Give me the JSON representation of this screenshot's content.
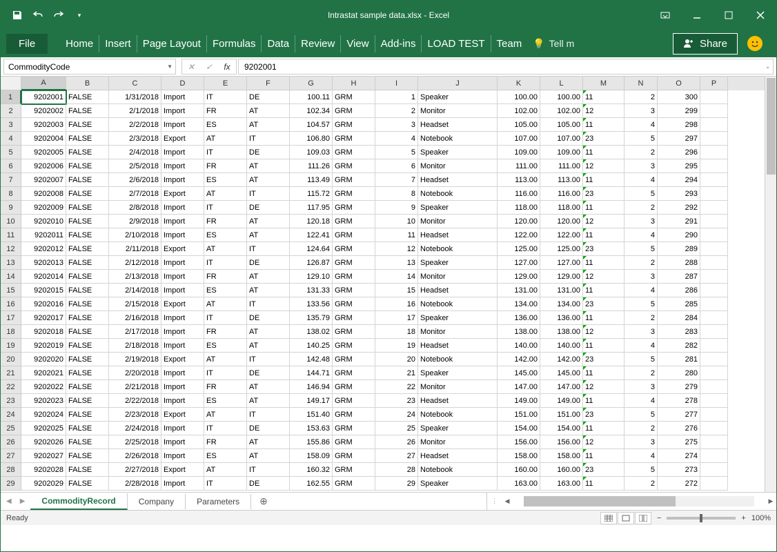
{
  "title": "Intrastat sample data.xlsx - Excel",
  "ribbon": {
    "file": "File",
    "tabs": [
      "Home",
      "Insert",
      "Page Layout",
      "Formulas",
      "Data",
      "Review",
      "View",
      "Add-ins",
      "LOAD TEST",
      "Team"
    ],
    "tell_me": "Tell m",
    "share": "Share"
  },
  "namebox": "CommodityCode",
  "formula": "9202001",
  "columns": [
    "A",
    "B",
    "C",
    "D",
    "E",
    "F",
    "G",
    "H",
    "I",
    "J",
    "K",
    "L",
    "M",
    "N",
    "O",
    "P"
  ],
  "rows": [
    {
      "n": 1,
      "A": "9202001",
      "B": "FALSE",
      "C": "1/31/2018",
      "D": "Import",
      "E": "IT",
      "F": "DE",
      "G": "100.11",
      "H": "GRM",
      "I": "1",
      "J": "Speaker",
      "K": "100.00",
      "L": "100.00",
      "M": "11",
      "N": "2",
      "O": "300"
    },
    {
      "n": 2,
      "A": "9202002",
      "B": "FALSE",
      "C": "2/1/2018",
      "D": "Import",
      "E": "FR",
      "F": "AT",
      "G": "102.34",
      "H": "GRM",
      "I": "2",
      "J": "Monitor",
      "K": "102.00",
      "L": "102.00",
      "M": "12",
      "N": "3",
      "O": "299"
    },
    {
      "n": 3,
      "A": "9202003",
      "B": "FALSE",
      "C": "2/2/2018",
      "D": "Import",
      "E": "ES",
      "F": "AT",
      "G": "104.57",
      "H": "GRM",
      "I": "3",
      "J": "Headset",
      "K": "105.00",
      "L": "105.00",
      "M": "11",
      "N": "4",
      "O": "298"
    },
    {
      "n": 4,
      "A": "9202004",
      "B": "FALSE",
      "C": "2/3/2018",
      "D": "Export",
      "E": "AT",
      "F": "IT",
      "G": "106.80",
      "H": "GRM",
      "I": "4",
      "J": "Notebook",
      "K": "107.00",
      "L": "107.00",
      "M": "23",
      "N": "5",
      "O": "297"
    },
    {
      "n": 5,
      "A": "9202005",
      "B": "FALSE",
      "C": "2/4/2018",
      "D": "Import",
      "E": "IT",
      "F": "DE",
      "G": "109.03",
      "H": "GRM",
      "I": "5",
      "J": "Speaker",
      "K": "109.00",
      "L": "109.00",
      "M": "11",
      "N": "2",
      "O": "296"
    },
    {
      "n": 6,
      "A": "9202006",
      "B": "FALSE",
      "C": "2/5/2018",
      "D": "Import",
      "E": "FR",
      "F": "AT",
      "G": "111.26",
      "H": "GRM",
      "I": "6",
      "J": "Monitor",
      "K": "111.00",
      "L": "111.00",
      "M": "12",
      "N": "3",
      "O": "295"
    },
    {
      "n": 7,
      "A": "9202007",
      "B": "FALSE",
      "C": "2/6/2018",
      "D": "Import",
      "E": "ES",
      "F": "AT",
      "G": "113.49",
      "H": "GRM",
      "I": "7",
      "J": "Headset",
      "K": "113.00",
      "L": "113.00",
      "M": "11",
      "N": "4",
      "O": "294"
    },
    {
      "n": 8,
      "A": "9202008",
      "B": "FALSE",
      "C": "2/7/2018",
      "D": "Export",
      "E": "AT",
      "F": "IT",
      "G": "115.72",
      "H": "GRM",
      "I": "8",
      "J": "Notebook",
      "K": "116.00",
      "L": "116.00",
      "M": "23",
      "N": "5",
      "O": "293"
    },
    {
      "n": 9,
      "A": "9202009",
      "B": "FALSE",
      "C": "2/8/2018",
      "D": "Import",
      "E": "IT",
      "F": "DE",
      "G": "117.95",
      "H": "GRM",
      "I": "9",
      "J": "Speaker",
      "K": "118.00",
      "L": "118.00",
      "M": "11",
      "N": "2",
      "O": "292"
    },
    {
      "n": 10,
      "A": "9202010",
      "B": "FALSE",
      "C": "2/9/2018",
      "D": "Import",
      "E": "FR",
      "F": "AT",
      "G": "120.18",
      "H": "GRM",
      "I": "10",
      "J": "Monitor",
      "K": "120.00",
      "L": "120.00",
      "M": "12",
      "N": "3",
      "O": "291"
    },
    {
      "n": 11,
      "A": "9202011",
      "B": "FALSE",
      "C": "2/10/2018",
      "D": "Import",
      "E": "ES",
      "F": "AT",
      "G": "122.41",
      "H": "GRM",
      "I": "11",
      "J": "Headset",
      "K": "122.00",
      "L": "122.00",
      "M": "11",
      "N": "4",
      "O": "290"
    },
    {
      "n": 12,
      "A": "9202012",
      "B": "FALSE",
      "C": "2/11/2018",
      "D": "Export",
      "E": "AT",
      "F": "IT",
      "G": "124.64",
      "H": "GRM",
      "I": "12",
      "J": "Notebook",
      "K": "125.00",
      "L": "125.00",
      "M": "23",
      "N": "5",
      "O": "289"
    },
    {
      "n": 13,
      "A": "9202013",
      "B": "FALSE",
      "C": "2/12/2018",
      "D": "Import",
      "E": "IT",
      "F": "DE",
      "G": "126.87",
      "H": "GRM",
      "I": "13",
      "J": "Speaker",
      "K": "127.00",
      "L": "127.00",
      "M": "11",
      "N": "2",
      "O": "288"
    },
    {
      "n": 14,
      "A": "9202014",
      "B": "FALSE",
      "C": "2/13/2018",
      "D": "Import",
      "E": "FR",
      "F": "AT",
      "G": "129.10",
      "H": "GRM",
      "I": "14",
      "J": "Monitor",
      "K": "129.00",
      "L": "129.00",
      "M": "12",
      "N": "3",
      "O": "287"
    },
    {
      "n": 15,
      "A": "9202015",
      "B": "FALSE",
      "C": "2/14/2018",
      "D": "Import",
      "E": "ES",
      "F": "AT",
      "G": "131.33",
      "H": "GRM",
      "I": "15",
      "J": "Headset",
      "K": "131.00",
      "L": "131.00",
      "M": "11",
      "N": "4",
      "O": "286"
    },
    {
      "n": 16,
      "A": "9202016",
      "B": "FALSE",
      "C": "2/15/2018",
      "D": "Export",
      "E": "AT",
      "F": "IT",
      "G": "133.56",
      "H": "GRM",
      "I": "16",
      "J": "Notebook",
      "K": "134.00",
      "L": "134.00",
      "M": "23",
      "N": "5",
      "O": "285"
    },
    {
      "n": 17,
      "A": "9202017",
      "B": "FALSE",
      "C": "2/16/2018",
      "D": "Import",
      "E": "IT",
      "F": "DE",
      "G": "135.79",
      "H": "GRM",
      "I": "17",
      "J": "Speaker",
      "K": "136.00",
      "L": "136.00",
      "M": "11",
      "N": "2",
      "O": "284"
    },
    {
      "n": 18,
      "A": "9202018",
      "B": "FALSE",
      "C": "2/17/2018",
      "D": "Import",
      "E": "FR",
      "F": "AT",
      "G": "138.02",
      "H": "GRM",
      "I": "18",
      "J": "Monitor",
      "K": "138.00",
      "L": "138.00",
      "M": "12",
      "N": "3",
      "O": "283"
    },
    {
      "n": 19,
      "A": "9202019",
      "B": "FALSE",
      "C": "2/18/2018",
      "D": "Import",
      "E": "ES",
      "F": "AT",
      "G": "140.25",
      "H": "GRM",
      "I": "19",
      "J": "Headset",
      "K": "140.00",
      "L": "140.00",
      "M": "11",
      "N": "4",
      "O": "282"
    },
    {
      "n": 20,
      "A": "9202020",
      "B": "FALSE",
      "C": "2/19/2018",
      "D": "Export",
      "E": "AT",
      "F": "IT",
      "G": "142.48",
      "H": "GRM",
      "I": "20",
      "J": "Notebook",
      "K": "142.00",
      "L": "142.00",
      "M": "23",
      "N": "5",
      "O": "281"
    },
    {
      "n": 21,
      "A": "9202021",
      "B": "FALSE",
      "C": "2/20/2018",
      "D": "Import",
      "E": "IT",
      "F": "DE",
      "G": "144.71",
      "H": "GRM",
      "I": "21",
      "J": "Speaker",
      "K": "145.00",
      "L": "145.00",
      "M": "11",
      "N": "2",
      "O": "280"
    },
    {
      "n": 22,
      "A": "9202022",
      "B": "FALSE",
      "C": "2/21/2018",
      "D": "Import",
      "E": "FR",
      "F": "AT",
      "G": "146.94",
      "H": "GRM",
      "I": "22",
      "J": "Monitor",
      "K": "147.00",
      "L": "147.00",
      "M": "12",
      "N": "3",
      "O": "279"
    },
    {
      "n": 23,
      "A": "9202023",
      "B": "FALSE",
      "C": "2/22/2018",
      "D": "Import",
      "E": "ES",
      "F": "AT",
      "G": "149.17",
      "H": "GRM",
      "I": "23",
      "J": "Headset",
      "K": "149.00",
      "L": "149.00",
      "M": "11",
      "N": "4",
      "O": "278"
    },
    {
      "n": 24,
      "A": "9202024",
      "B": "FALSE",
      "C": "2/23/2018",
      "D": "Export",
      "E": "AT",
      "F": "IT",
      "G": "151.40",
      "H": "GRM",
      "I": "24",
      "J": "Notebook",
      "K": "151.00",
      "L": "151.00",
      "M": "23",
      "N": "5",
      "O": "277"
    },
    {
      "n": 25,
      "A": "9202025",
      "B": "FALSE",
      "C": "2/24/2018",
      "D": "Import",
      "E": "IT",
      "F": "DE",
      "G": "153.63",
      "H": "GRM",
      "I": "25",
      "J": "Speaker",
      "K": "154.00",
      "L": "154.00",
      "M": "11",
      "N": "2",
      "O": "276"
    },
    {
      "n": 26,
      "A": "9202026",
      "B": "FALSE",
      "C": "2/25/2018",
      "D": "Import",
      "E": "FR",
      "F": "AT",
      "G": "155.86",
      "H": "GRM",
      "I": "26",
      "J": "Monitor",
      "K": "156.00",
      "L": "156.00",
      "M": "12",
      "N": "3",
      "O": "275"
    },
    {
      "n": 27,
      "A": "9202027",
      "B": "FALSE",
      "C": "2/26/2018",
      "D": "Import",
      "E": "ES",
      "F": "AT",
      "G": "158.09",
      "H": "GRM",
      "I": "27",
      "J": "Headset",
      "K": "158.00",
      "L": "158.00",
      "M": "11",
      "N": "4",
      "O": "274"
    },
    {
      "n": 28,
      "A": "9202028",
      "B": "FALSE",
      "C": "2/27/2018",
      "D": "Export",
      "E": "AT",
      "F": "IT",
      "G": "160.32",
      "H": "GRM",
      "I": "28",
      "J": "Notebook",
      "K": "160.00",
      "L": "160.00",
      "M": "23",
      "N": "5",
      "O": "273"
    },
    {
      "n": 29,
      "A": "9202029",
      "B": "FALSE",
      "C": "2/28/2018",
      "D": "Import",
      "E": "IT",
      "F": "DE",
      "G": "162.55",
      "H": "GRM",
      "I": "29",
      "J": "Speaker",
      "K": "163.00",
      "L": "163.00",
      "M": "11",
      "N": "2",
      "O": "272"
    }
  ],
  "sheets": {
    "active": "CommodityRecord",
    "others": [
      "Company",
      "Parameters"
    ]
  },
  "status": {
    "ready": "Ready",
    "zoom": "100%"
  }
}
